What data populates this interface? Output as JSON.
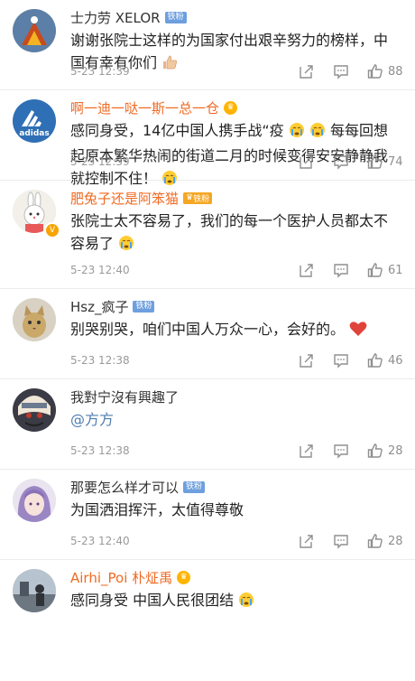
{
  "comments": [
    {
      "username": "士力劳 XELOR",
      "badge": "铁粉",
      "text": "谢谢张院士这样的为国家付出艰辛努力的榜样，中国有幸有你们",
      "emoji": "thumbs-up",
      "time": "5-23 12:39",
      "likes": "88",
      "avatar": "flower-on-blue"
    },
    {
      "username": "啊一迪一哒一斯一总一仓",
      "badge": "",
      "crown_icon": "crown-icon",
      "text_parts": [
        "感同身受，14亿中国人携手战“疫",
        "每每回想起原本繁华热闹的街道二月的时候变得安安静静我就控制不住！"
      ],
      "emoji": "crying-face",
      "time": "5-23 12:39",
      "likes": "74",
      "avatar": "adidas-logo",
      "logo_text": "adidas"
    },
    {
      "username": "肥兔子还是阿笨猫",
      "badge": "铁粉",
      "text": "张院士太不容易了，我们的每一个医护人员都太不容易了",
      "emoji": "crying-face",
      "time": "5-23 12:40",
      "likes": "61",
      "avatar": "white-rabbit"
    },
    {
      "username": "Hsz_疯子",
      "badge": "铁粉",
      "text": "别哭别哭，咱们中国人万众一心，会好的。",
      "emoji": "red-heart",
      "time": "5-23 12:38",
      "likes": "46",
      "avatar": "cat-photo"
    },
    {
      "username": "我對宁沒有興趣了",
      "badge": "",
      "mention": "@方方",
      "time": "5-23 12:38",
      "likes": "28",
      "avatar": "anime-ninja"
    },
    {
      "username": "那要怎么样才可以",
      "badge": "铁粉",
      "text": "为国洒泪挥汗，太值得尊敬",
      "time": "5-23 12:40",
      "likes": "28",
      "avatar": "purple-hair-girl"
    },
    {
      "username": "Airhi_Poi 朴炡禹",
      "badge": "",
      "text": "感同身受 中国人民很团结",
      "emoji": "crying-face",
      "avatar": "street-photo"
    }
  ],
  "colors": {
    "vip_name": "#f06a22",
    "mention": "#507daf",
    "fan_badge": "#6e9fde",
    "meta_gray": "#9a9a9a"
  }
}
